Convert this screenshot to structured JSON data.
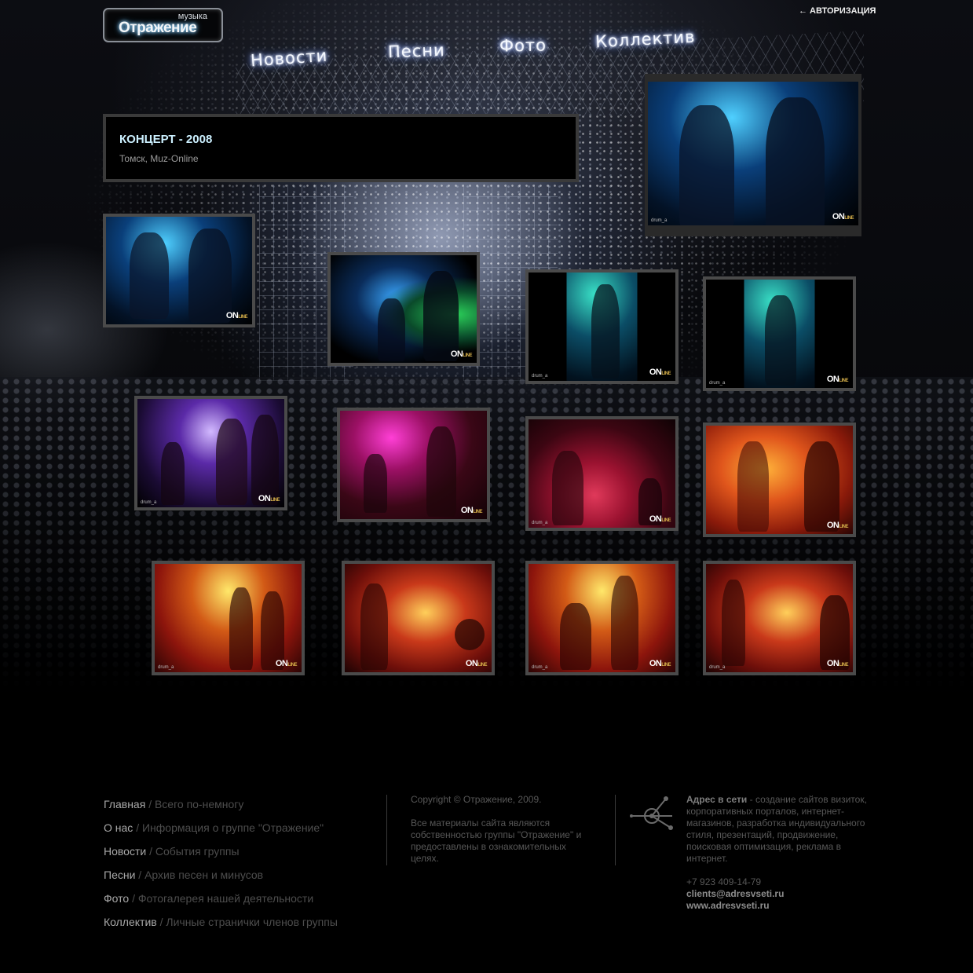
{
  "header": {
    "logo": {
      "small": "музыка",
      "main": "Отражение"
    },
    "auth_link": "← АВТОРИЗАЦИЯ"
  },
  "nav": [
    "Новости",
    "Песни",
    "Фото",
    "Коллектив"
  ],
  "gallery": {
    "title": "КОНЦЕРТ - 2008",
    "subtitle": "Томск, Muz-Online",
    "watermark": "ON",
    "watermark_small": "LINE",
    "credit": "drum_a"
  },
  "footer": {
    "nav": [
      {
        "label": "Главная",
        "desc": "/ Всего по-немногу"
      },
      {
        "label": "О нас",
        "desc": "/ Информация о группе \"Отражение\""
      },
      {
        "label": "Новости",
        "desc": "/ События группы"
      },
      {
        "label": "Песни",
        "desc": "/ Архив песен и минусов"
      },
      {
        "label": "Фото",
        "desc": "/ Фотогалерея нашей деятельности"
      },
      {
        "label": "Коллектив",
        "desc": "/ Личные странички членов группы"
      }
    ],
    "copyright": "Copyright © Отражение, 2009.",
    "rights": "Все материалы сайта являются собственностью группы \"Отражение\" и предоставлены в ознакомительных целях.",
    "developer": {
      "name": "Адрес в сети",
      "text": " - создание сайтов визиток, корпоративных порталов, интернет-магазинов, разработка индивидуального стиля, презентаций, продвижение, поисковая оптимизация, реклама в интернет.",
      "phone": "+7 923 409-14-79",
      "email": "clients@adresvseti.ru",
      "site": "www.adresvseti.ru"
    }
  },
  "colors": {
    "background": "#000000",
    "title": "#ccf0ff",
    "photo_border": "#4a4a4a",
    "footer_link": "#a9a9a9",
    "footer_desc": "#4d4d4d"
  }
}
